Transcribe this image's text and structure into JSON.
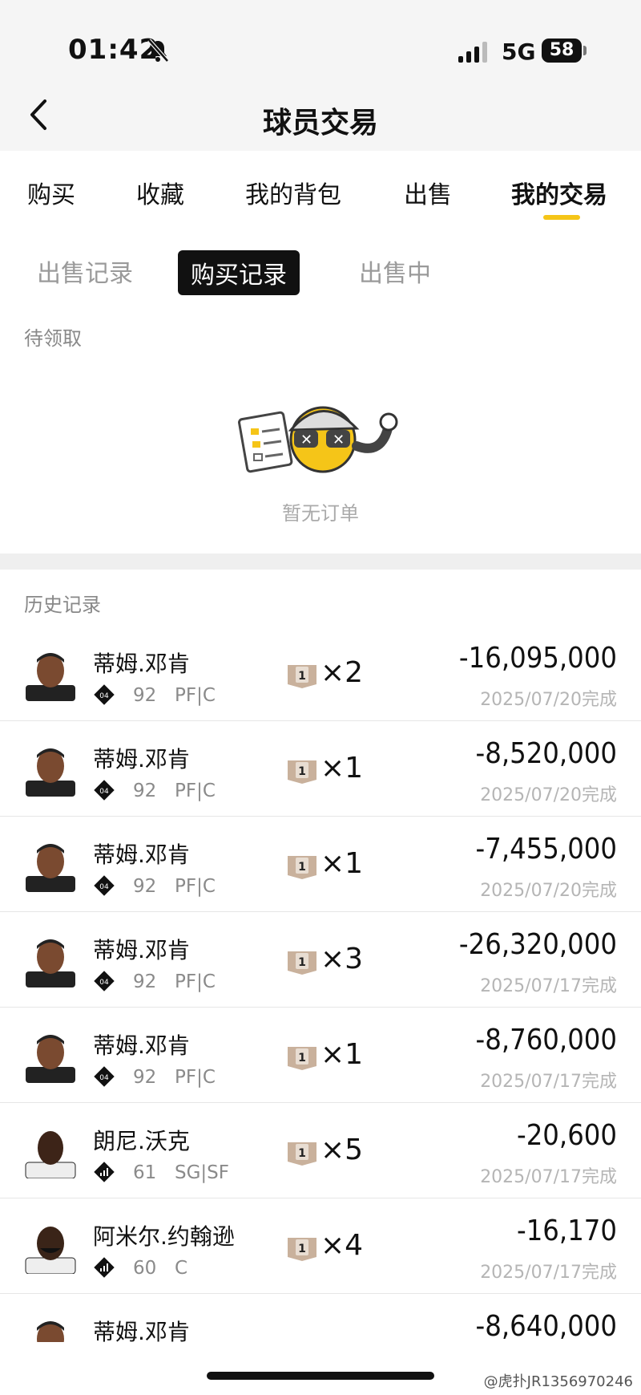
{
  "status": {
    "time": "01:42",
    "network": "5G",
    "battery": "58"
  },
  "header": {
    "title": "球员交易"
  },
  "tabs": [
    {
      "label": "购买"
    },
    {
      "label": "收藏"
    },
    {
      "label": "我的背包"
    },
    {
      "label": "出售"
    },
    {
      "label": "我的交易",
      "active": true
    }
  ],
  "subtabs": [
    {
      "label": "出售记录"
    },
    {
      "label": "购买记录",
      "active": true
    },
    {
      "label": "出售中"
    }
  ],
  "pending": {
    "label": "待领取",
    "empty_text": "暂无订单"
  },
  "history": {
    "label": "历史记录",
    "rows": [
      {
        "name": "蒂姆.邓肯",
        "badge": "04",
        "rating": "92",
        "position": "PF|C",
        "card": "1",
        "qty": "×2",
        "amount": "-16,095,000",
        "date": "2025/07/20完成"
      },
      {
        "name": "蒂姆.邓肯",
        "badge": "04",
        "rating": "92",
        "position": "PF|C",
        "card": "1",
        "qty": "×1",
        "amount": "-8,520,000",
        "date": "2025/07/20完成"
      },
      {
        "name": "蒂姆.邓肯",
        "badge": "04",
        "rating": "92",
        "position": "PF|C",
        "card": "1",
        "qty": "×1",
        "amount": "-7,455,000",
        "date": "2025/07/20完成"
      },
      {
        "name": "蒂姆.邓肯",
        "badge": "04",
        "rating": "92",
        "position": "PF|C",
        "card": "1",
        "qty": "×3",
        "amount": "-26,320,000",
        "date": "2025/07/17完成"
      },
      {
        "name": "蒂姆.邓肯",
        "badge": "04",
        "rating": "92",
        "position": "PF|C",
        "card": "1",
        "qty": "×1",
        "amount": "-8,760,000",
        "date": "2025/07/17完成"
      },
      {
        "name": "朗尼.沃克",
        "badge": "",
        "rating": "61",
        "position": "SG|SF",
        "card": "1",
        "qty": "×5",
        "amount": "-20,600",
        "date": "2025/07/17完成"
      },
      {
        "name": "阿米尔.约翰逊",
        "badge": "",
        "rating": "60",
        "position": "C",
        "card": "1",
        "qty": "×4",
        "amount": "-16,170",
        "date": "2025/07/17完成"
      },
      {
        "name": "蒂姆.邓肯",
        "badge": "",
        "rating": "",
        "position": "",
        "card": "",
        "qty": "",
        "amount": "-8,640,000",
        "date": ""
      }
    ]
  },
  "watermark": "@虎扑JR1356970246",
  "colors": {
    "accent": "#f5c518",
    "chip": "#c9b19c"
  }
}
